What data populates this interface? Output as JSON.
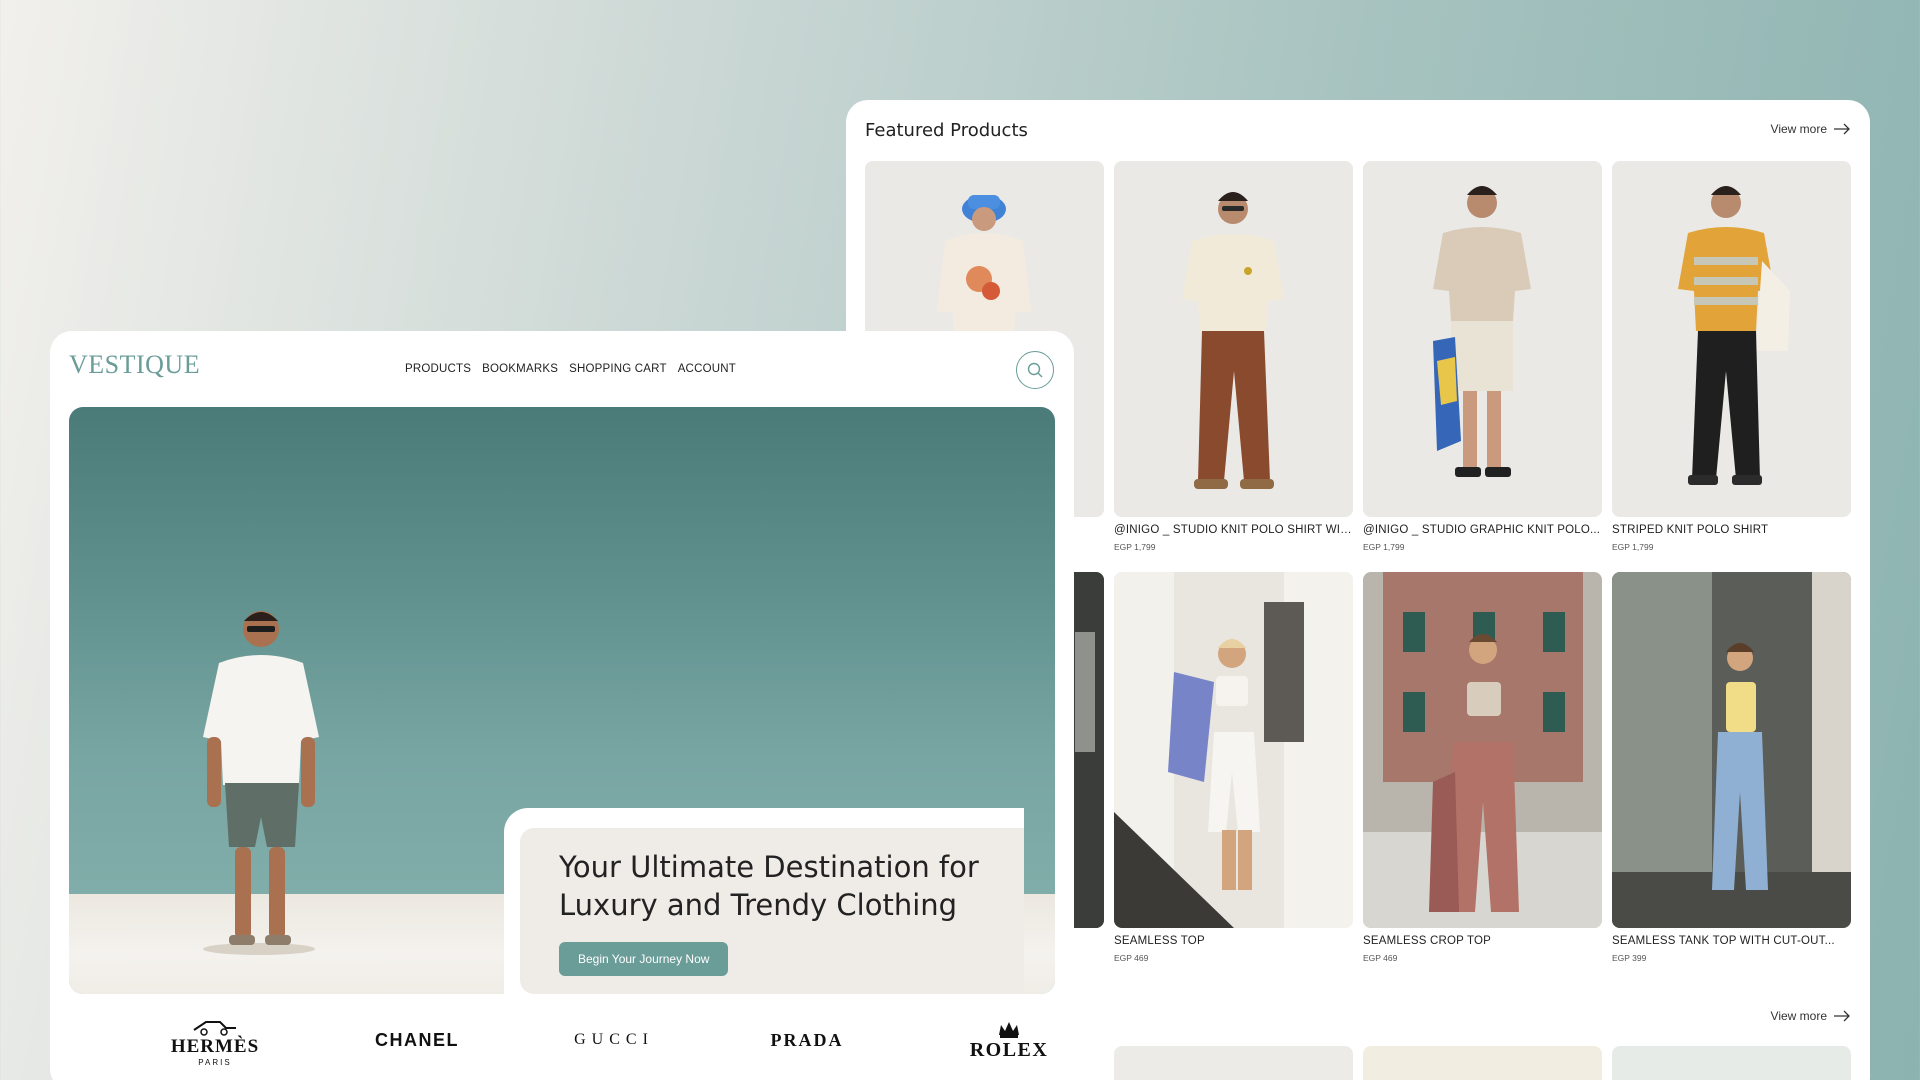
{
  "featured": {
    "title": "Featured Products",
    "view_more": "View more",
    "view_more_bottom": "View more",
    "row1": [
      {
        "name": "",
        "price": ""
      },
      {
        "name": "@INIGO _ STUDIO KNIT POLO SHIRT WIT...",
        "price": "EGP 1,799"
      },
      {
        "name": "@INIGO _ STUDIO GRAPHIC KNIT POLO...",
        "price": "EGP 1,799"
      },
      {
        "name": "STRIPED KNIT POLO SHIRT",
        "price": "EGP 1,799"
      }
    ],
    "row2": [
      {
        "name": "",
        "price": ""
      },
      {
        "name": "SEAMLESS TOP",
        "price": "EGP 469"
      },
      {
        "name": "SEAMLESS CROP TOP",
        "price": "EGP 469"
      },
      {
        "name": "SEAMLESS TANK TOP WITH CUT-OUT...",
        "price": "EGP 399"
      }
    ]
  },
  "home": {
    "logo": "VESTIQUE",
    "nav": [
      "PRODUCTS",
      "BOOKMARKS",
      "SHOPPING CART",
      "ACCOUNT"
    ],
    "hero_title": "Your Ultimate Destination for Luxury and Trendy Clothing",
    "cta": "Begin Your Journey Now",
    "brands": [
      {
        "name": "HERMÈS",
        "sub": "PARIS"
      },
      {
        "name": "CHANEL",
        "sub": ""
      },
      {
        "name": "GUCCI",
        "sub": ""
      },
      {
        "name": "PRADA",
        "sub": ""
      },
      {
        "name": "ROLEX",
        "sub": ""
      }
    ]
  },
  "colors": {
    "accent": "#6a9c98",
    "sky_top": "#4b7b79",
    "sky_bottom": "#87b1ae"
  }
}
